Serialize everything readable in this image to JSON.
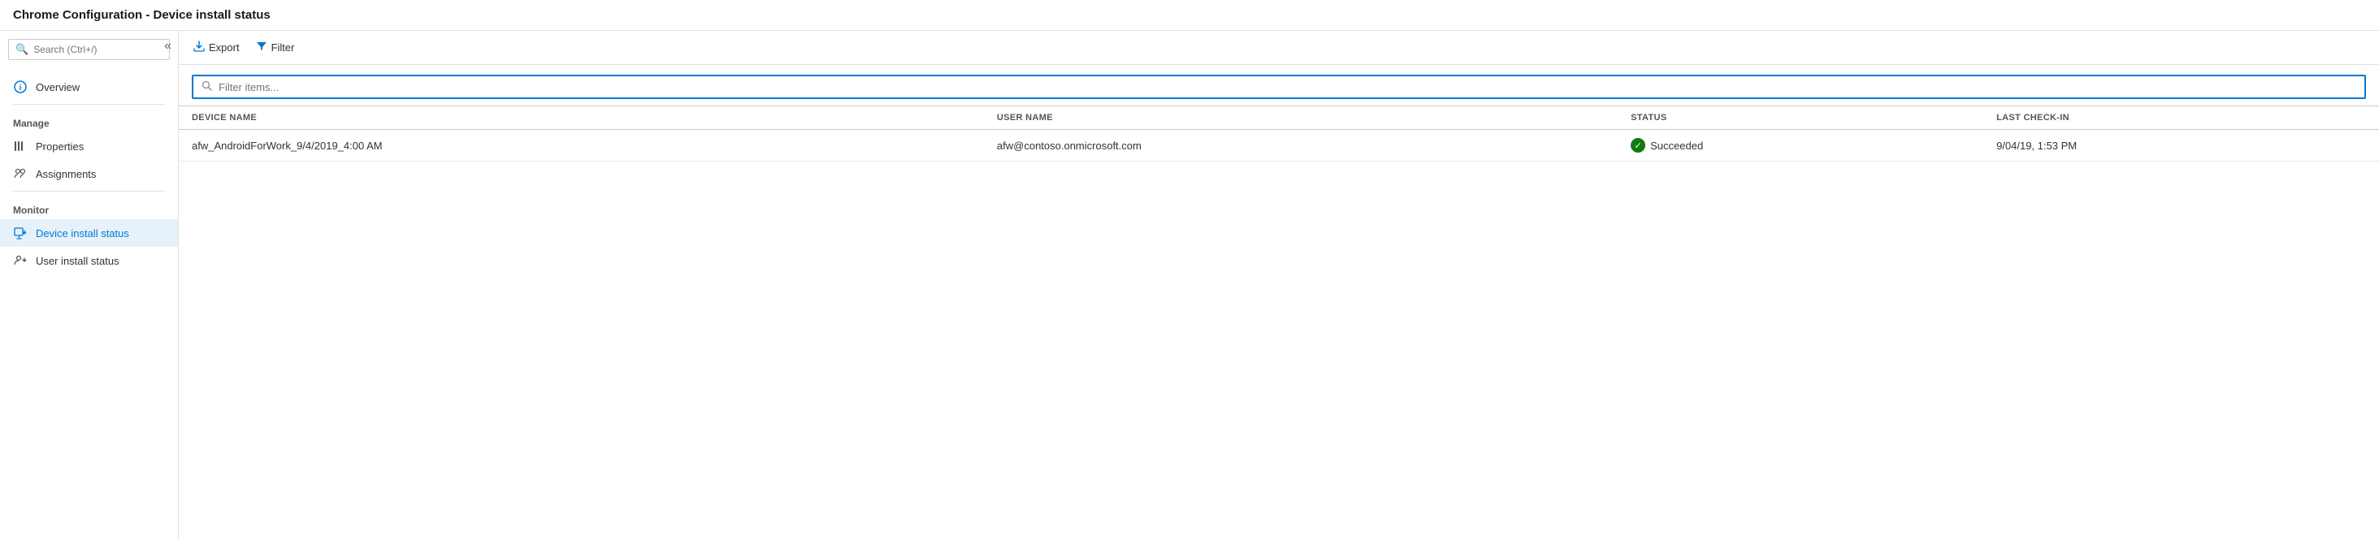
{
  "titleBar": {
    "text": "Chrome Configuration - Device install status"
  },
  "sidebar": {
    "collapseLabel": "«",
    "search": {
      "placeholder": "Search (Ctrl+/)"
    },
    "items": [
      {
        "id": "overview",
        "label": "Overview",
        "section": null,
        "active": false,
        "iconType": "info"
      },
      {
        "id": "properties",
        "label": "Properties",
        "section": "Manage",
        "active": false,
        "iconType": "properties"
      },
      {
        "id": "assignments",
        "label": "Assignments",
        "section": null,
        "active": false,
        "iconType": "assignments"
      },
      {
        "id": "device-install-status",
        "label": "Device install status",
        "section": "Monitor",
        "active": true,
        "iconType": "device-install"
      },
      {
        "id": "user-install-status",
        "label": "User install status",
        "section": null,
        "active": false,
        "iconType": "user-install"
      }
    ],
    "sections": [
      "Manage",
      "Monitor"
    ]
  },
  "toolbar": {
    "exportLabel": "Export",
    "filterLabel": "Filter"
  },
  "filterBar": {
    "placeholder": "Filter items..."
  },
  "table": {
    "columns": [
      {
        "id": "device-name",
        "label": "DEVICE NAME"
      },
      {
        "id": "user-name",
        "label": "USER NAME"
      },
      {
        "id": "status",
        "label": "STATUS"
      },
      {
        "id": "last-check-in",
        "label": "LAST CHECK-IN"
      }
    ],
    "rows": [
      {
        "deviceName": "afw_AndroidForWork_9/4/2019_4:00 AM",
        "userName": "afw@contoso.onmicrosoft.com",
        "status": "Succeeded",
        "statusType": "success",
        "lastCheckIn": "9/04/19, 1:53 PM"
      }
    ]
  }
}
